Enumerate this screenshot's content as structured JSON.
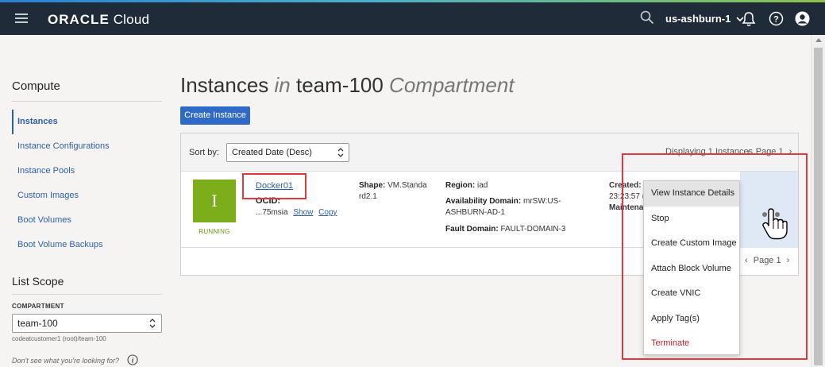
{
  "header": {
    "brand_bold": "ORACLE",
    "brand_light": " Cloud",
    "region": "us-ashburn-1",
    "icons": [
      "menu-icon",
      "search-icon",
      "chevron-down-icon",
      "bell-icon",
      "help-icon",
      "user-icon"
    ]
  },
  "sidebar": {
    "title": "Compute",
    "items": [
      {
        "label": "Instances",
        "active": true
      },
      {
        "label": "Instance Configurations",
        "active": false
      },
      {
        "label": "Instance Pools",
        "active": false
      },
      {
        "label": "Custom Images",
        "active": false
      },
      {
        "label": "Boot Volumes",
        "active": false
      },
      {
        "label": "Boot Volume Backups",
        "active": false
      }
    ],
    "scope_title": "List Scope",
    "compartment_label": "COMPARTMENT",
    "compartment_value": "team-100",
    "compartment_path": "codeatcustomer1 (root)/team-100",
    "dont_see": "Don't see what you're looking for?"
  },
  "main": {
    "title_a": "Instances",
    "title_in": " in ",
    "title_b": "team-100",
    "title_c": " Compartment",
    "create_button": "Create Instance",
    "sort_label": "Sort by:",
    "sort_value": "Created Date (Desc)",
    "displaying": "Displaying 1 Instances",
    "page_label": "Page 1"
  },
  "instance": {
    "initial": "I",
    "status": "RUNNING",
    "name": "Docker01",
    "ocid_label": "OCID:",
    "ocid_value": "...75msia",
    "show": "Show",
    "copy": "Copy",
    "shape_label": "Shape:",
    "shape_value": " VM.Standa rd2.1",
    "region_label": "Region:",
    "region_value": " iad",
    "ad_label": "Availability Domain:",
    "ad_value": " mrSW:US-ASHBURN-AD-1",
    "fd_label": "Fault Domain:",
    "fd_value": " FAULT-DOMAIN-3",
    "created_label": "Created:",
    "created_value": "23:23:57 (",
    "maint_label": "Maintena"
  },
  "menu": {
    "items": [
      {
        "label": "View Instance Details",
        "hover": true,
        "danger": false
      },
      {
        "label": "Stop",
        "hover": false,
        "danger": false
      },
      {
        "label": "Create Custom Image",
        "hover": false,
        "danger": false
      },
      {
        "label": "Attach Block Volume",
        "hover": false,
        "danger": false
      },
      {
        "label": "Create VNIC",
        "hover": false,
        "danger": false
      },
      {
        "label": "Apply Tag(s)",
        "hover": false,
        "danger": false
      },
      {
        "label": "Terminate",
        "hover": false,
        "danger": true
      }
    ]
  },
  "colors": {
    "topbar": "#1f2b38",
    "accent": "#2f6ac6",
    "link": "#2f5fa6",
    "running": "#7cad1b",
    "danger": "#c0262d",
    "highlight": "#e0393e"
  }
}
